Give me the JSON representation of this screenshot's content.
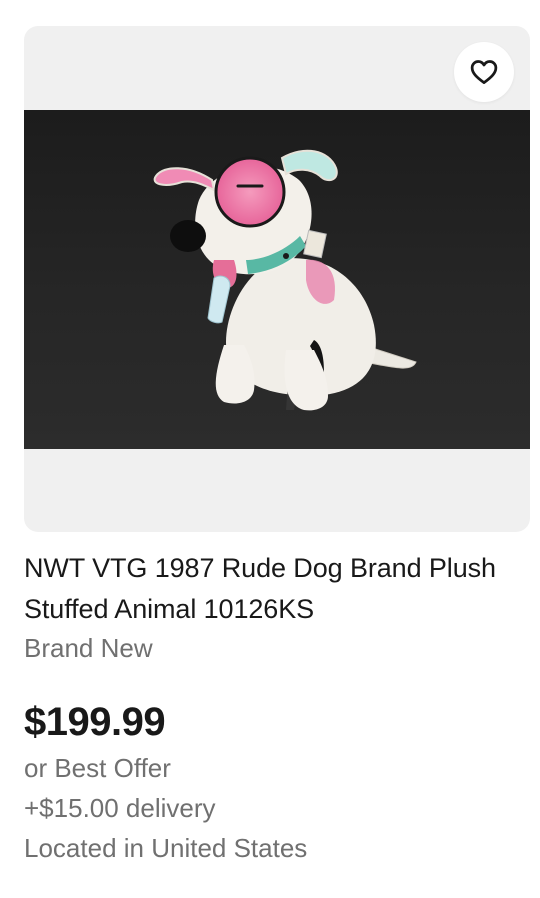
{
  "listing": {
    "title": "NWT VTG 1987 Rude Dog Brand Plush Stuffed Animal 10126KS",
    "condition": "Brand New",
    "price": "$199.99",
    "buying_format": "or Best Offer",
    "delivery": "+$15.00 delivery",
    "location": "Located in United States"
  },
  "watch_button": {
    "icon": "heart-outline-icon",
    "watched": false
  },
  "colors": {
    "frame_background": "#f0f0f0",
    "photo_background": "#222222",
    "secondary_text": "#707070",
    "primary_text": "#191919"
  }
}
